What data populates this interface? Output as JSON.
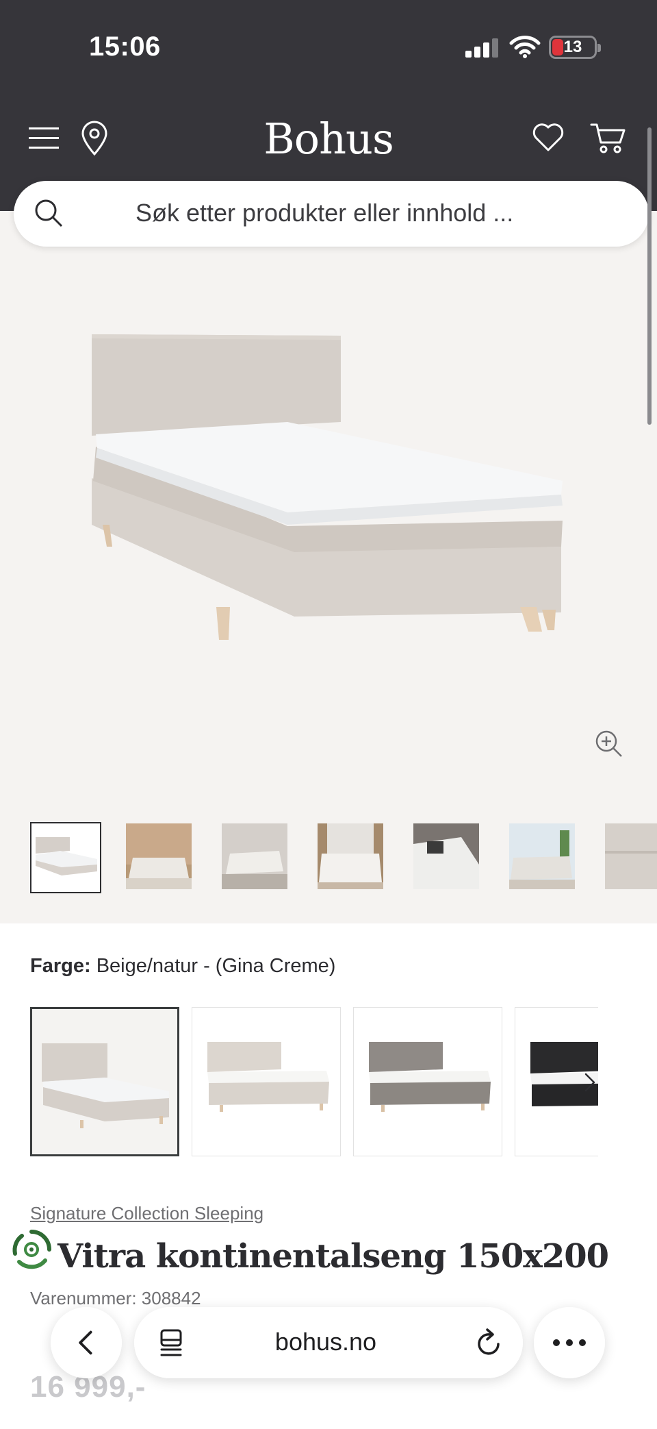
{
  "status_bar": {
    "time": "15:06",
    "battery": "13"
  },
  "header": {
    "logo": "Bohus"
  },
  "search": {
    "placeholder": "Søk etter produkter eller innhold ..."
  },
  "gallery": {
    "thumbnail_count": 7
  },
  "color": {
    "label": "Farge:",
    "value": "Beige/natur - (Gina Creme)"
  },
  "product": {
    "brand": "Signature Collection Sleeping",
    "title": "Vitra kontinentalseng 150x200",
    "sku": "Varenummer: 308842",
    "price": "16 999,-"
  },
  "browser": {
    "url": "bohus.no"
  },
  "colors": {
    "brand_dark": "#36353a",
    "hero_bg": "#f5f3f1",
    "battery_low": "#e0343b"
  }
}
